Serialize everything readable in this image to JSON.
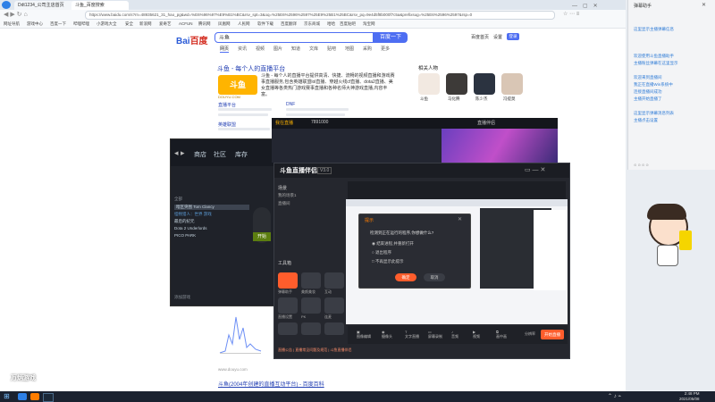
{
  "browser": {
    "tabs": [
      "Ddt1234_公司主店首页",
      "斗鱼_百度搜索"
    ],
    "url": "https://www.baidu.com/s?rn=48935621_31_hao_pg&wd=%E6%96%97%E9%B1%BC&rsv_spt=3&oq=%25E6%2596%2597%25E9%25B1%25BC&rsv_pq=9e4d5f8b000f7c5a&prefixsug=%25E6%2596%2597&rsp=0",
    "bookmarks": [
      "网址导航",
      "游戏中心",
      "百度一下",
      "哔哩哔哩",
      "小游戏大全",
      "安全",
      "新浪网",
      "爱奇艺",
      "ACFUN",
      "腾讯网",
      "凤凰网",
      "人民网",
      "软件下载",
      "百度翻译",
      "京东商城",
      "哈哈",
      "百度贴吧",
      "淘宝网"
    ]
  },
  "baidu": {
    "logo_left": "Bai",
    "logo_right": "百度",
    "query": "斗鱼",
    "search_button": "百度一下",
    "top_links": [
      "百度首页",
      "设置"
    ],
    "login": "登录",
    "search_tabs": [
      "网页",
      "资讯",
      "视频",
      "图片",
      "知道",
      "文库",
      "贴吧",
      "地图",
      "采购",
      "更多"
    ],
    "result_title": "斗鱼 - 每个人的直播平台",
    "result_desc": "斗鱼 - 每个人的直播平台提供高清、快捷、流畅的视频直播和游戏赛事直播服务,包含英雄联盟lol直播、穿越火线cf直播、dota2直播、美女直播等各类热门游戏赛事直播和各种名师大神游戏直播,内容丰富。",
    "douyu_logo": "斗鱼",
    "douyu_domain": "DOUYU.COM",
    "sub_links": [
      "直播平台",
      "DNF",
      "英雄联盟",
      "游戏直播"
    ],
    "related_title": "相关人物",
    "related_people": [
      "斗鱼",
      "马化腾",
      "陈少杰",
      "冯提莫"
    ],
    "bottom_link": "斗鱼(2004年创建的直播互动平台) - 百度百科",
    "bottom_url": "www.douyu.com"
  },
  "sidebar": {
    "title": "弹幕助手",
    "lines": [
      "这里显示主播弹幕信息",
      "",
      "欢迎使用斗鱼直播助手",
      "主播粉丝弹幕在这里显示",
      "欢迎来到直播间",
      "",
      "我正在直播Win系统中",
      "连接直播间成功",
      "主播开始直播了",
      "",
      "这里显示弹幕消息列表",
      "主播点击设置",
      ""
    ]
  },
  "dark_window": {
    "nav": [
      "商店",
      "社区",
      "库存"
    ],
    "filter": "全部",
    "games": [
      "暗区突围 Tom Clancy",
      "怪物猎人：世界 游戏",
      "最后的纪元",
      "Dota 2 Underlords",
      "PICO PARK"
    ],
    "play": "开始",
    "bottom": "添加游戏"
  },
  "live_top": {
    "title": "我在直播",
    "room": "7891000",
    "right": "直播伴侣"
  },
  "obs": {
    "logo": "斗鱼直播伴侣",
    "version": "V3.0",
    "scene_label": "场景",
    "scenes": [
      "我的场景1",
      "直播间"
    ],
    "tools_label": "工具箱",
    "tools": [
      "弹幕助手",
      "美颜美妆",
      "互动",
      "直播设置",
      "PK",
      "连麦",
      "贴纸",
      "滤镜",
      "更多"
    ],
    "footer_link": "直播公告 | 直播常见问题及规范 | 斗鱼直播伴侣",
    "bottom_icons": [
      "图像编辑",
      "摄像头",
      "文字直播",
      "屏幕录制",
      "音频",
      "视频",
      "画中画"
    ],
    "bottom_right": "分辨率",
    "go_live": "开始直播"
  },
  "dialog": {
    "title": "提示",
    "question": "检测到正在运行的程序,你想做什么?",
    "options": [
      "结束进程,并重新打开",
      "退出程序",
      "不再显示此提示"
    ],
    "ok": "确定",
    "cancel": "取消"
  },
  "taskbar": {
    "time": "2:48 PM",
    "date": "2021/05/08",
    "watermark": "万炳游戏"
  },
  "colors": {
    "baidu_blue": "#4e6ef2",
    "baidu_red": "#d32a1e",
    "douyu_orange": "#ff7d00",
    "dark_bg": "#1f2229"
  }
}
